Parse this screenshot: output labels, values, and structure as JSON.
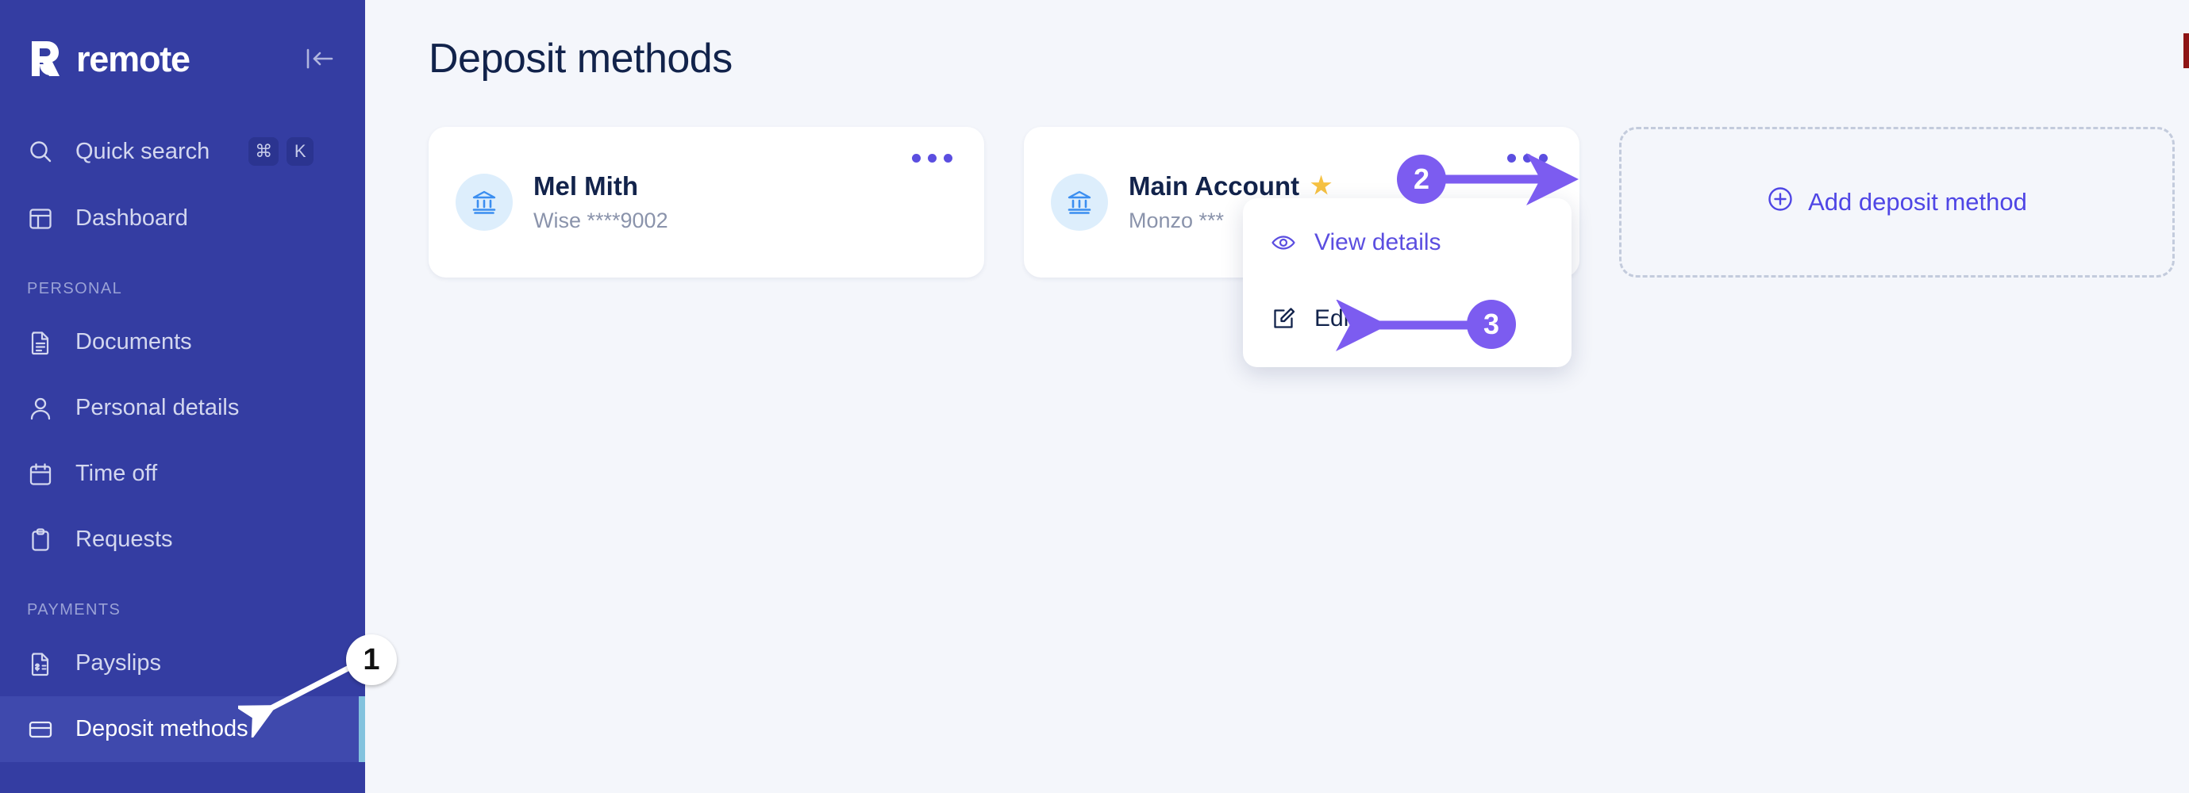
{
  "sidebar": {
    "brand": "remote",
    "brand_icon": "remote-logo-icon",
    "collapse_icon": "collapse-panel-icon",
    "quick_search": {
      "label": "Quick search",
      "icon": "search-icon",
      "keys": [
        "⌘",
        "K"
      ]
    },
    "top_items": [
      {
        "label": "Dashboard",
        "icon": "dashboard-layout-icon",
        "active": false
      }
    ],
    "sections": [
      {
        "title": "PERSONAL",
        "items": [
          {
            "label": "Documents",
            "icon": "document-icon",
            "active": false
          },
          {
            "label": "Personal details",
            "icon": "user-icon",
            "active": false
          },
          {
            "label": "Time off",
            "icon": "calendar-icon",
            "active": false
          },
          {
            "label": "Requests",
            "icon": "clipboard-icon",
            "active": false
          }
        ]
      },
      {
        "title": "PAYMENTS",
        "items": [
          {
            "label": "Payslips",
            "icon": "payslip-dollar-doc-icon",
            "active": false
          },
          {
            "label": "Deposit methods",
            "icon": "credit-card-icon",
            "active": true
          }
        ]
      }
    ],
    "colors": {
      "background": "#343da2",
      "active_background": "#3f49ad",
      "active_accent": "#83c3de",
      "label": "#d3d7ef",
      "section_label": "#9aa2d6"
    }
  },
  "main": {
    "page_title": "Deposit methods",
    "deposit_methods": [
      {
        "name": "Mel Mith",
        "subtitle": "Wise ****9002",
        "icon": "bank-icon",
        "primary": false,
        "kebab_icon": "more-options-icon"
      },
      {
        "name": "Main Account",
        "subtitle": "Monzo ***",
        "icon": "bank-icon",
        "primary": true,
        "primary_icon": "star-icon",
        "kebab_icon": "more-options-icon"
      }
    ],
    "add_card": {
      "label": "Add deposit method",
      "icon": "plus-circle-icon"
    },
    "colors": {
      "background": "#f4f6fb",
      "card": "#ffffff",
      "title": "#12234b",
      "subtitle": "#8a93ab",
      "accent": "#5b4ee0",
      "bank_icon_bg": "#ddeefc",
      "star": "#f6c243"
    }
  },
  "dropdown": {
    "items": [
      {
        "label": "View details",
        "icon": "eye-icon",
        "highlighted": true
      },
      {
        "label": "Edit",
        "icon": "edit-pencil-icon",
        "highlighted": false
      }
    ]
  },
  "annotations": [
    {
      "number": "1",
      "style": "white",
      "points_to": "sidebar-item-deposit-methods"
    },
    {
      "number": "2",
      "style": "purple",
      "points_to": "card-kebab-main-account"
    },
    {
      "number": "3",
      "style": "purple",
      "points_to": "menu-item-edit"
    }
  ],
  "annotation_color": "#7c5cf0"
}
